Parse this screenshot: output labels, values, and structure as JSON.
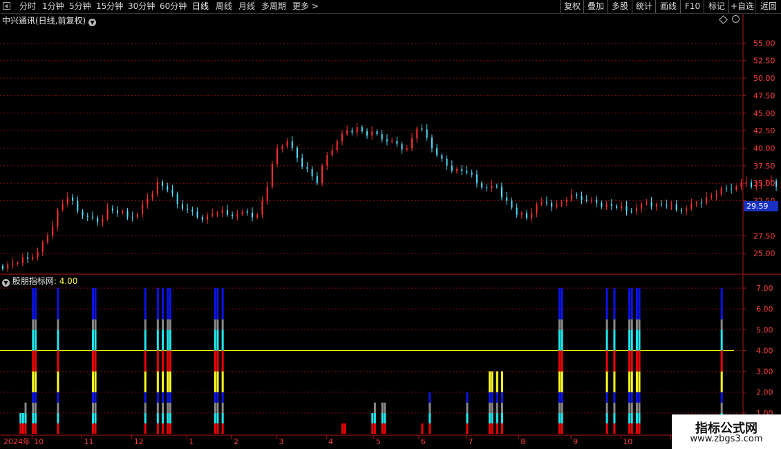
{
  "toolbar": {
    "periods": [
      "分时",
      "1分钟",
      "5分钟",
      "15分钟",
      "30分钟",
      "60分钟",
      "日线",
      "周线",
      "月线",
      "多周期",
      "更多 >"
    ],
    "active_period": "日线",
    "right_buttons": [
      "复权",
      "叠加",
      "多股",
      "统计",
      "画线",
      "F10",
      "标记",
      "+自选",
      "返回"
    ]
  },
  "main_chart": {
    "title": "中兴通讯(日线,前复权)",
    "current_price_label": "29.59"
  },
  "indicator": {
    "name": "股朋指标网",
    "value_text": ": 4.00"
  },
  "watermark": {
    "line1": "指标公式网",
    "line2": "www.zbgs3.com"
  },
  "colors": {
    "up": "#ff3030",
    "down": "#50e0ff",
    "grid": "#8a1010",
    "axis": "#b01818",
    "axis_text": "#ff4040",
    "guide_line": "#ffff00",
    "current_price_bg": "#1830c0",
    "bar_red": "#ee0000",
    "bar_cyan": "#20e8ee",
    "bar_gray": "#888888",
    "bar_blue": "#0a14e6",
    "bar_yellow": "#ffff20"
  },
  "chart_data": [
    {
      "type": "candlestick",
      "title": "中兴通讯(日线,前复权)",
      "ylim": [
        22.5,
        57.5
      ],
      "y_ticks": [
        "55.00",
        "52.50",
        "50.00",
        "47.50",
        "45.00",
        "42.50",
        "40.00",
        "37.50",
        "35.00",
        "32.50",
        "27.50",
        "25.00"
      ],
      "x_labels": [
        "2024年",
        "10",
        "11",
        "12",
        "1",
        "2",
        "3",
        "4",
        "5",
        "6",
        "7",
        "8",
        "9",
        "10",
        "12"
      ],
      "current_price": 29.59,
      "closes": [
        23.4,
        23.6,
        24.2,
        25.2,
        27.5,
        31.2,
        33.0,
        31.0,
        30.2,
        29.4,
        31.4,
        30.8,
        30.2,
        30.6,
        32.8,
        35.2,
        34.0,
        32.0,
        31.2,
        30.2,
        30.4,
        30.8,
        30.5,
        30.6,
        30.8,
        30.5,
        34.5,
        40.0,
        41.0,
        38.6,
        37.0,
        35.0,
        39.0,
        41.0,
        42.5,
        43.0,
        41.8,
        42.0,
        41.0,
        40.6,
        40.0,
        42.8,
        41.5,
        39.0,
        37.5,
        37.0,
        36.5,
        35.0,
        34.3,
        34.5,
        32.5,
        30.5,
        30.0,
        32.0,
        32.2,
        32.0,
        32.6,
        33.2,
        32.5,
        32.2,
        32.0,
        31.5,
        31.0,
        31.4,
        32.3,
        32.0,
        31.8,
        31.2,
        31.4,
        32.2,
        33.0,
        33.4,
        34.2,
        34.5,
        35.1,
        34.8,
        35.2,
        34.5,
        35.0,
        34.8,
        39.0,
        46.0,
        45.0,
        47.5,
        44.0,
        41.0,
        43.0,
        45.0,
        44.5,
        45.8,
        45.0,
        46.5,
        49.0,
        51.8,
        51.5,
        50.0,
        48.0,
        49.5,
        46.5,
        44.0,
        42.0,
        40.0,
        40.5,
        39.5,
        39.0,
        41.0,
        43.0,
        46.5,
        43.0,
        42.0,
        38.8,
        37.2
      ],
      "x_axis_month_positions_days": [
        0,
        12,
        32,
        52,
        74,
        92,
        110,
        130,
        149,
        167,
        186,
        207,
        228,
        248,
        268
      ]
    },
    {
      "type": "bar",
      "title": "股朋指标网",
      "value": 4.0,
      "ylim": [
        0,
        7.5
      ],
      "y_ticks": [
        "7.00",
        "6.00",
        "5.00",
        "4.00",
        "3.00",
        "2.00",
        "1.00"
      ],
      "reference_line": 4.0,
      "segment_colors": [
        "bar_red",
        "bar_cyan",
        "bar_gray",
        "bar_blue",
        "bar_yellow",
        "bar_red",
        "bar_cyan",
        "bar_gray",
        "bar_blue"
      ],
      "segment_boundaries": [
        0,
        0.5,
        1.0,
        1.5,
        2.0,
        3.0,
        4.0,
        5.0,
        5.5,
        7.0
      ],
      "stacks": [
        {
          "day": 7,
          "top": 1.0
        },
        {
          "day": 8,
          "top": 1.0
        },
        {
          "day": 9,
          "top": 1.5
        },
        {
          "day": 12,
          "top": 7.0
        },
        {
          "day": 13,
          "top": 7.0
        },
        {
          "day": 22,
          "top": 7.0
        },
        {
          "day": 36,
          "top": 7.0
        },
        {
          "day": 37,
          "top": 7.0
        },
        {
          "day": 57,
          "top": 7.0
        },
        {
          "day": 62,
          "top": 7.0
        },
        {
          "day": 64,
          "top": 7.0
        },
        {
          "day": 66,
          "top": 7.0
        },
        {
          "day": 67,
          "top": 7.0
        },
        {
          "day": 85,
          "top": 7.0
        },
        {
          "day": 86,
          "top": 7.0
        },
        {
          "day": 88,
          "top": 7.0
        },
        {
          "day": 136,
          "top": 0.5
        },
        {
          "day": 137,
          "top": 0.5
        },
        {
          "day": 148,
          "top": 1.0
        },
        {
          "day": 149,
          "top": 1.5
        },
        {
          "day": 152,
          "top": 1.5
        },
        {
          "day": 153,
          "top": 1.5
        },
        {
          "day": 168,
          "top": 0.5
        },
        {
          "day": 171,
          "top": 2.0
        },
        {
          "day": 186,
          "top": 2.0
        },
        {
          "day": 195,
          "top": 3.0
        },
        {
          "day": 196,
          "top": 3.0
        },
        {
          "day": 198,
          "top": 3.0
        },
        {
          "day": 200,
          "top": 3.0
        },
        {
          "day": 223,
          "top": 7.0
        },
        {
          "day": 224,
          "top": 7.0
        },
        {
          "day": 242,
          "top": 7.0
        },
        {
          "day": 245,
          "top": 7.0
        },
        {
          "day": 251,
          "top": 7.0
        },
        {
          "day": 252,
          "top": 7.0
        },
        {
          "day": 254,
          "top": 7.0
        },
        {
          "day": 255,
          "top": 7.0
        },
        {
          "day": 285,
          "top": 0.6
        },
        {
          "day": 286,
          "top": 0.6
        },
        {
          "day": 288,
          "top": 7.0
        }
      ]
    }
  ]
}
